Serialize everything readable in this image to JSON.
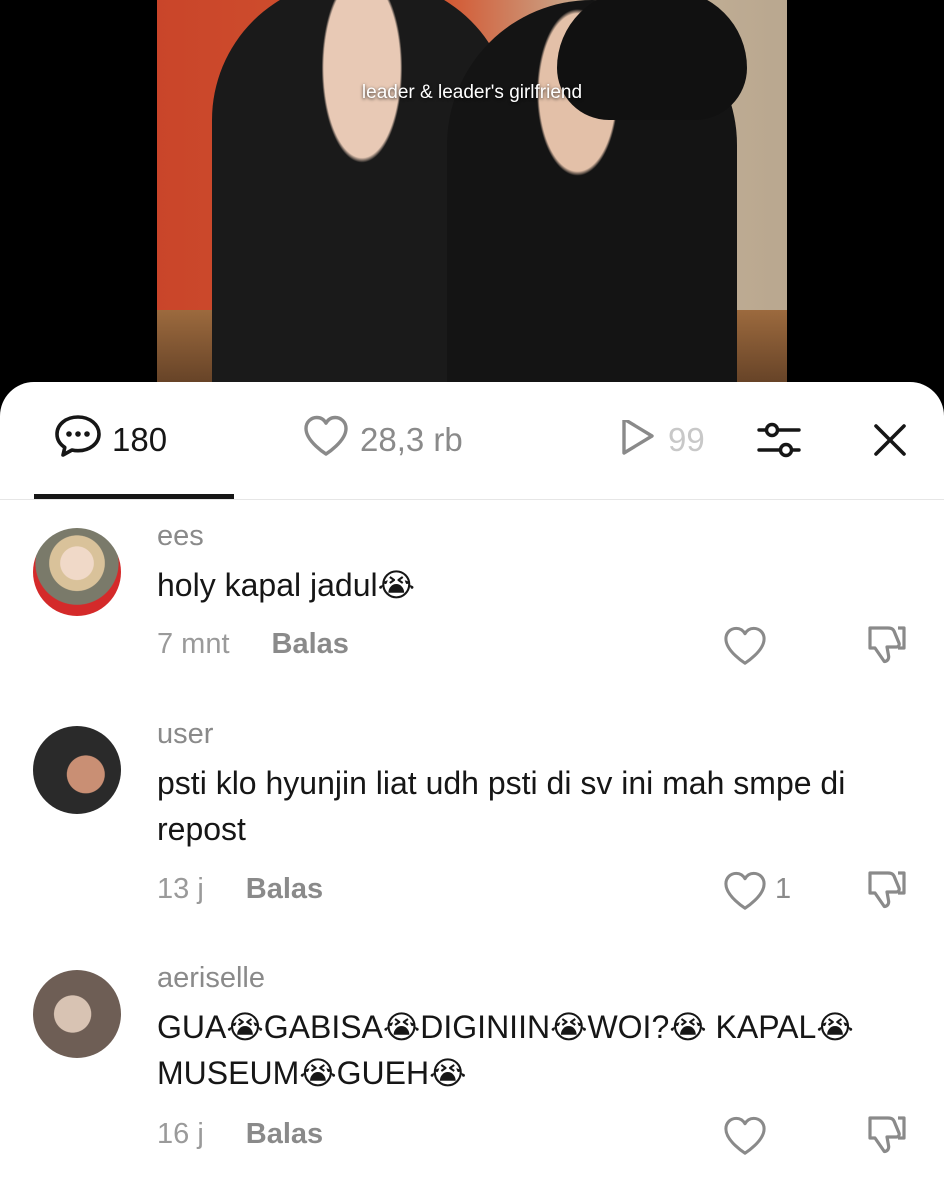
{
  "video": {
    "caption": "leader & leader's girlfriend"
  },
  "tabs": {
    "comments_count": "180",
    "likes_count": "28,3 rb",
    "views_count": "99"
  },
  "comments": [
    {
      "username": "ees",
      "text": "holy kapal jadul😭",
      "time": "7 mnt",
      "reply_label": "Balas",
      "likes": ""
    },
    {
      "username": "user",
      "text": "psti klo hyunjin liat udh psti di sv ini mah smpe di repost",
      "time": "13 j",
      "reply_label": "Balas",
      "likes": "1"
    },
    {
      "username": "aeriselle",
      "text": "GUA😭GABISA😭DIGINIIN😭WOI?😭 KAPAL😭 MUSEUM😭GUEH😭",
      "time": "16 j",
      "reply_label": "Balas",
      "likes": ""
    }
  ],
  "icons": {
    "comment": "speech-bubble-icon",
    "like": "heart-icon",
    "views": "play-icon",
    "filter": "sliders-icon",
    "close": "close-icon",
    "dislike": "thumbs-down-icon"
  }
}
